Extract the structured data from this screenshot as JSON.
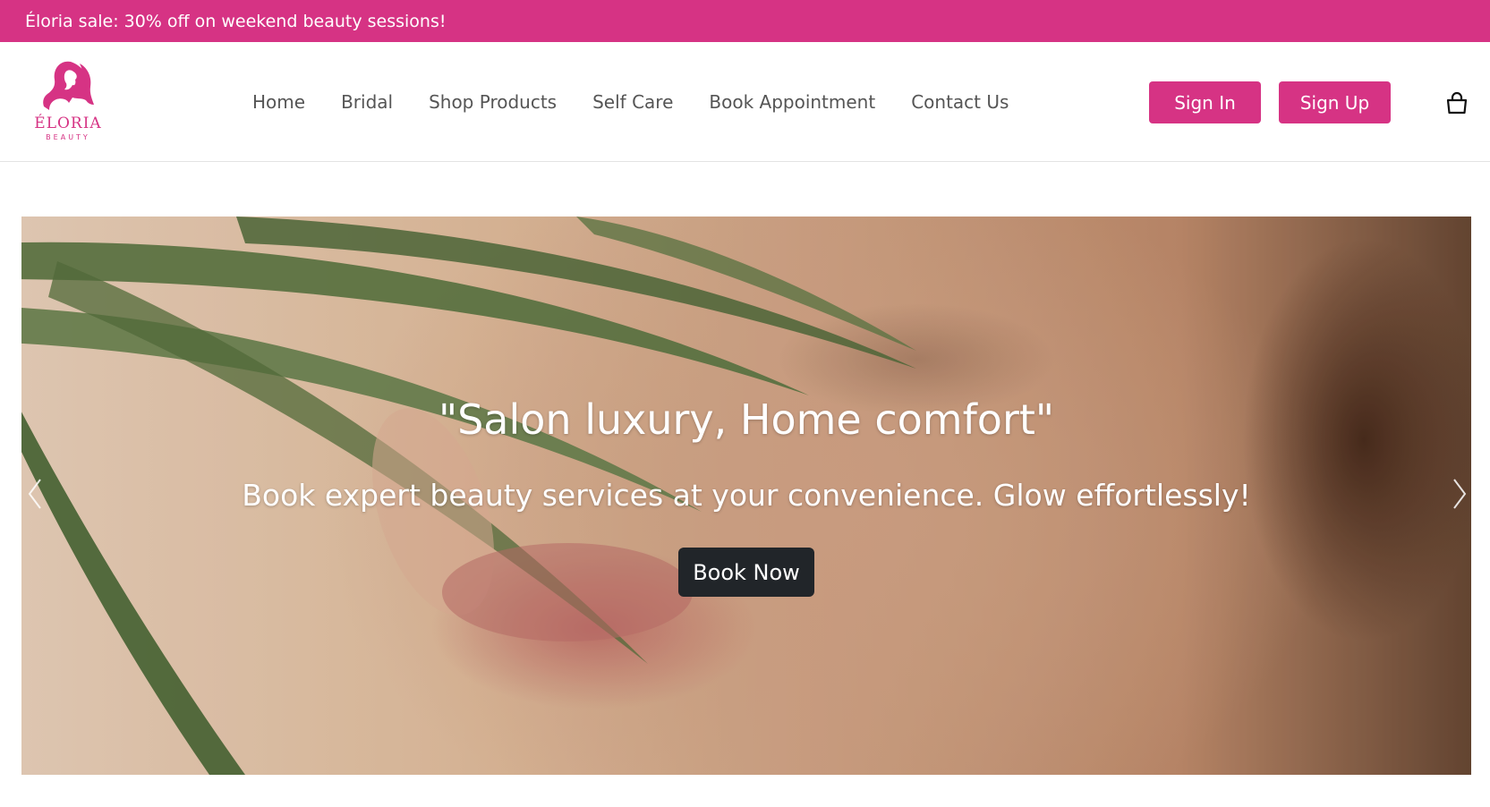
{
  "promo": {
    "text": "Éloria sale: 30% off on weekend beauty sessions!"
  },
  "brand": {
    "name": "ÉLORIA",
    "tagline": "BEAUTY"
  },
  "nav": {
    "items": [
      {
        "label": "Home"
      },
      {
        "label": "Bridal"
      },
      {
        "label": "Shop Products"
      },
      {
        "label": "Self Care"
      },
      {
        "label": "Book Appointment"
      },
      {
        "label": "Contact Us"
      }
    ]
  },
  "auth": {
    "sign_in": "Sign In",
    "sign_up": "Sign Up"
  },
  "cart": {
    "icon": "shopping-bag-icon"
  },
  "hero": {
    "title": "\"Salon luxury, Home comfort\"",
    "subtitle": "Book expert beauty services at your convenience. Glow effortlessly!",
    "cta": "Book Now",
    "prev_icon": "chevron-left-icon",
    "next_icon": "chevron-right-icon"
  },
  "colors": {
    "accent": "#d63384",
    "dark_button": "#212529",
    "nav_text": "#555555"
  }
}
